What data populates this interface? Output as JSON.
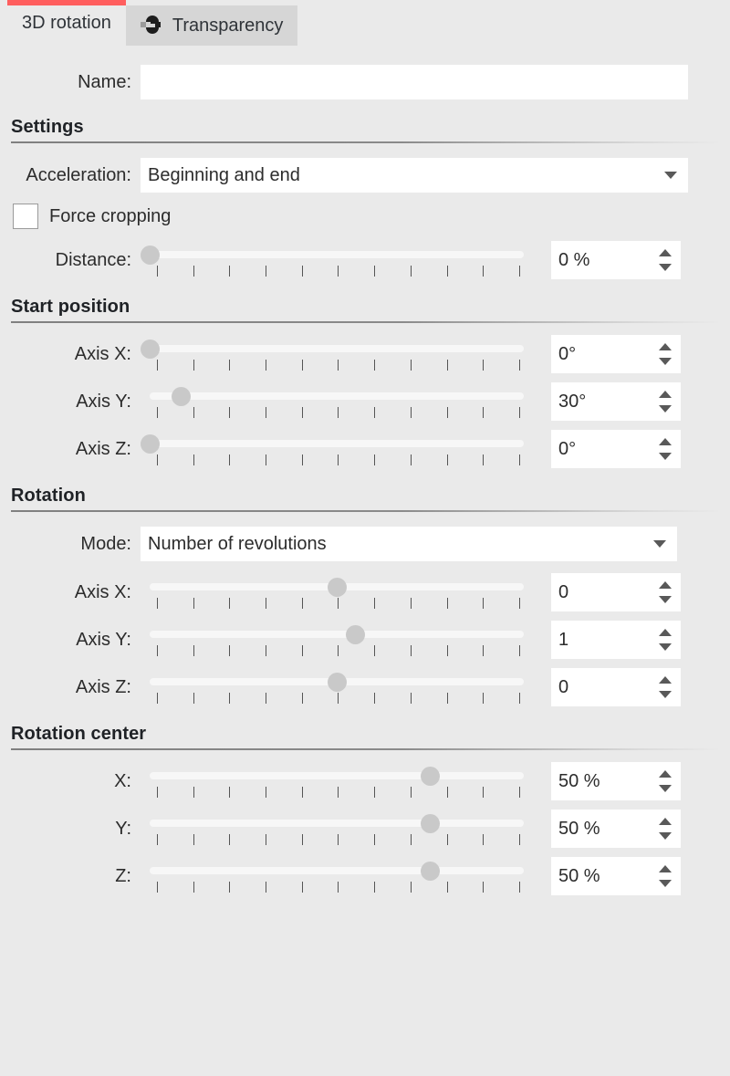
{
  "tabs": [
    {
      "label": "3D rotation",
      "active": true,
      "icon": "cube-rotate-icon"
    },
    {
      "label": "Transparency",
      "active": false,
      "icon": "transparency-icon"
    }
  ],
  "accent_color": "#ff5e5e",
  "name_field": {
    "label": "Name:",
    "value": "",
    "placeholder": ""
  },
  "sections": {
    "settings": {
      "title": "Settings",
      "acceleration": {
        "label": "Acceleration:",
        "value": "Beginning and end"
      },
      "force_cropping": {
        "label": "Force cropping",
        "checked": false
      },
      "distance": {
        "label": "Distance:",
        "value": "0 %",
        "handle_percent": 0
      }
    },
    "start_position": {
      "title": "Start position",
      "rows": [
        {
          "label": "Axis X:",
          "value": "0°",
          "handle_percent": 0
        },
        {
          "label": "Axis Y:",
          "value": "30°",
          "handle_percent": 8.3
        },
        {
          "label": "Axis Z:",
          "value": "0°",
          "handle_percent": 0
        }
      ]
    },
    "rotation": {
      "title": "Rotation",
      "mode": {
        "label": "Mode:",
        "value": "Number of revolutions"
      },
      "rows": [
        {
          "label": "Axis X:",
          "value": "0",
          "handle_percent": 50
        },
        {
          "label": "Axis Y:",
          "value": "1",
          "handle_percent": 55
        },
        {
          "label": "Axis Z:",
          "value": "0",
          "handle_percent": 50
        }
      ]
    },
    "rotation_center": {
      "title": "Rotation center",
      "rows": [
        {
          "label": "X:",
          "value": "50 %",
          "handle_percent": 75
        },
        {
          "label": "Y:",
          "value": "50 %",
          "handle_percent": 75
        },
        {
          "label": "Z:",
          "value": "50 %",
          "handle_percent": 75
        }
      ]
    }
  },
  "slider_tick_count": 11
}
